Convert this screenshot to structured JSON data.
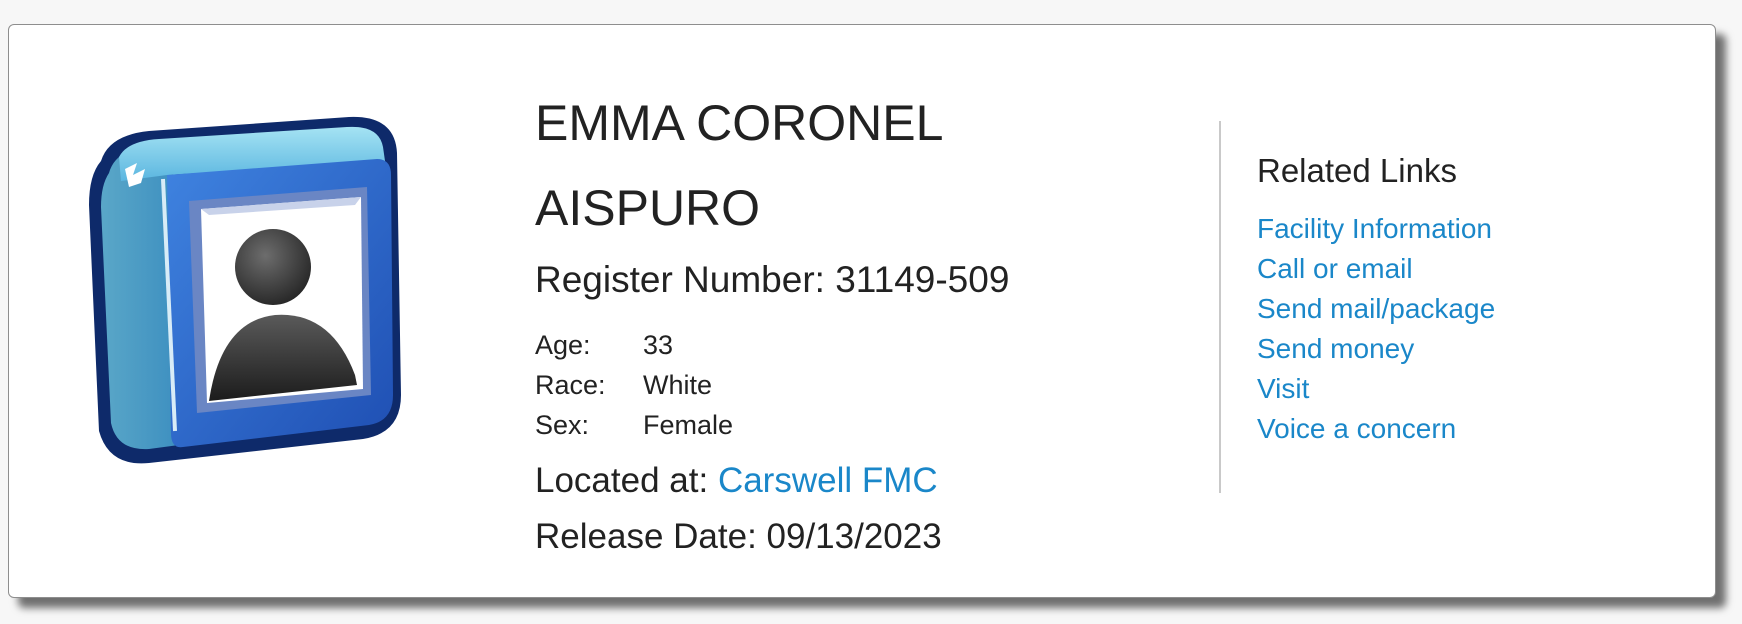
{
  "inmate": {
    "name_line1": "EMMA CORONEL",
    "name_line2": "AISPURO",
    "register_label": "Register Number:",
    "register_number": "31149-509",
    "age_label": "Age:",
    "age": "33",
    "race_label": "Race:",
    "race": "White",
    "sex_label": "Sex:",
    "sex": "Female",
    "located_label": "Located at:",
    "facility": "Carswell FMC",
    "release_label": "Release Date:",
    "release_date": "09/13/2023"
  },
  "related": {
    "title": "Related Links",
    "links": [
      "Facility Information",
      "Call or email",
      "Send mail/package",
      "Send money",
      "Visit",
      "Voice a concern"
    ]
  },
  "colors": {
    "link": "#1a87c9",
    "frame_blue": "#2f66c8",
    "frame_dark": "#0e2a6a"
  },
  "icons": {
    "photo": "person-silhouette-frame-icon"
  }
}
